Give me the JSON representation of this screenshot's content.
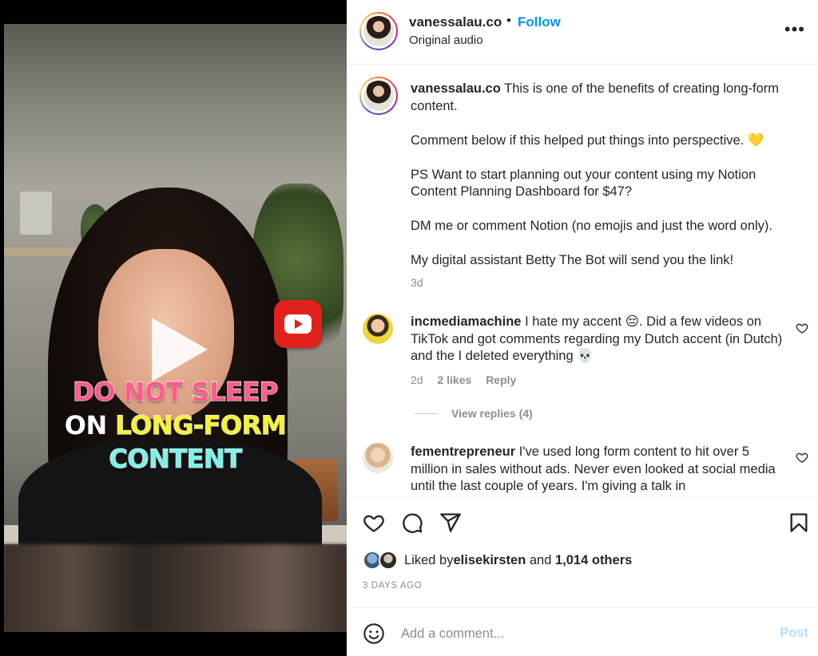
{
  "media": {
    "overlay_lines": [
      {
        "text": "DO NOT SLEEP",
        "style": "pink"
      },
      {
        "parts": [
          {
            "text": "ON ",
            "style": "white"
          },
          {
            "text": "LONG-FORM",
            "style": "yellow"
          }
        ]
      },
      {
        "text": "CONTENT",
        "style": "cyan"
      }
    ],
    "badge_icon": "youtube-icon"
  },
  "header": {
    "username": "vanessalau.co",
    "dot": "•",
    "follow_label": "Follow",
    "subtitle": "Original audio",
    "more_label": "•••"
  },
  "caption": {
    "username": "vanessalau.co",
    "first_line": " This is one of the benefits of creating long-form content.",
    "paragraphs": [
      "Comment below if this helped put things into perspective. 💛",
      "PS Want to start planning out your content using my Notion Content Planning Dashboard for $47?",
      "DM me or comment Notion (no emojis and just the word only).",
      "My digital assistant Betty The Bot will send you the link!"
    ],
    "time": "3d"
  },
  "comments": [
    {
      "username": "incmediamachine",
      "text": " I hate my accent 😔. Did a few videos on TikTok and got comments regarding my Dutch accent (in Dutch) and the I deleted everything 💀",
      "time": "2d",
      "likes": "2 likes",
      "reply_label": "Reply",
      "view_replies": "View replies (4)"
    },
    {
      "username": "fementrepreneur",
      "text": " I've used long form content to hit over 5 million in sales without ads. Never even looked at social media until the last couple of years. I'm giving a talk in"
    }
  ],
  "likes": {
    "prefix": "Liked by ",
    "user": "elisekirsten",
    "middle": " and ",
    "others": "1,014 others"
  },
  "posted": "3 DAYS AGO",
  "add_comment": {
    "placeholder": "Add a comment...",
    "post_label": "Post"
  },
  "colors": {
    "follow": "#0095f6",
    "post_disabled": "#b2dffc",
    "youtube_red": "#e1211b"
  }
}
